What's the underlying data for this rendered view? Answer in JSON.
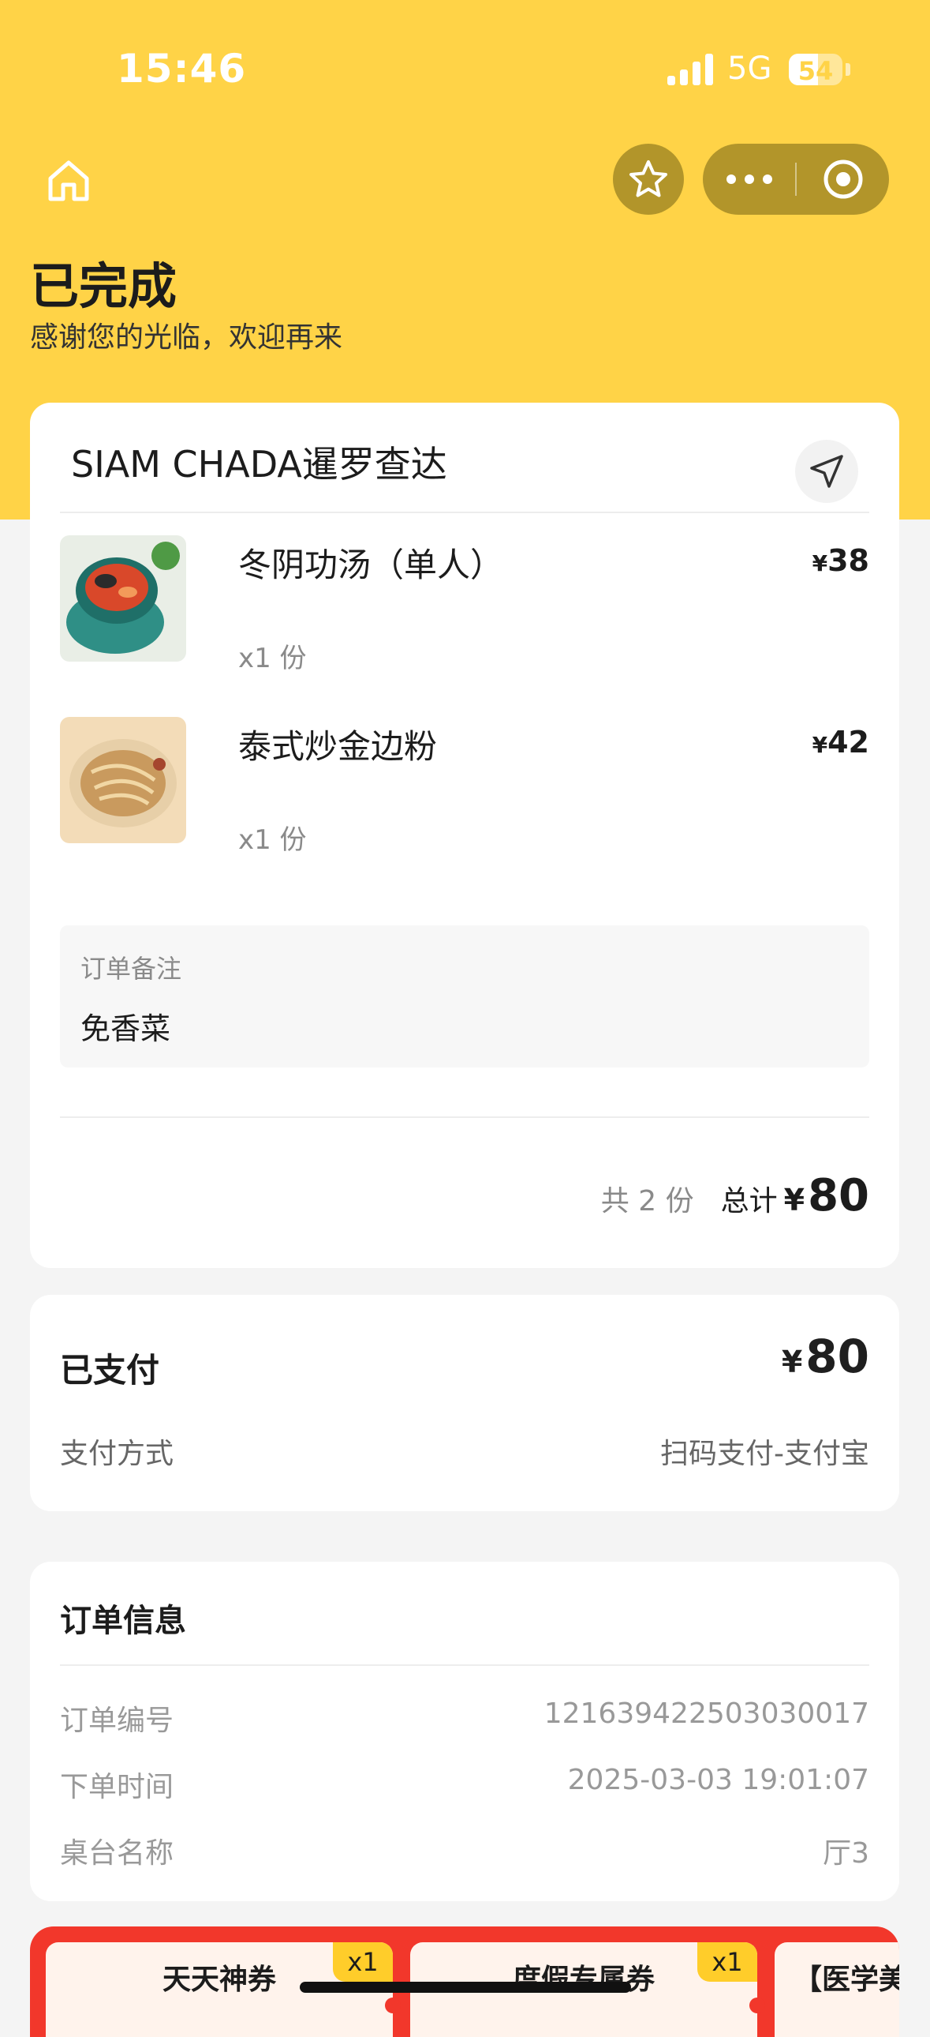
{
  "status_bar": {
    "time": "15:46",
    "network": "5G",
    "battery": "54",
    "battery_level": 0.54
  },
  "nav": {
    "home_icon": "home-icon",
    "star_icon": "star-icon",
    "more_icon": "more-dots-icon",
    "target_icon": "target-icon"
  },
  "order_status": {
    "title": "已完成",
    "subtitle": "感谢您的光临，欢迎再来"
  },
  "store": {
    "name": "SIAM CHADA暹罗查达",
    "nav_icon": "navigate-arrow-icon"
  },
  "items": [
    {
      "name": "冬阴功汤（单人）",
      "qty": "x1 份",
      "currency": "¥",
      "price": "38"
    },
    {
      "name": "泰式炒金边粉",
      "qty": "x1 份",
      "currency": "¥",
      "price": "42"
    }
  ],
  "remark": {
    "label": "订单备注",
    "value": "免香菜"
  },
  "totals": {
    "count_text": "共 2 份",
    "total_label": "总计",
    "currency": "¥",
    "amount": "80"
  },
  "payment": {
    "title": "已支付",
    "currency": "¥",
    "amount": "80",
    "method_label": "支付方式",
    "method_value": "扫码支付-支付宝"
  },
  "order_info": {
    "title": "订单信息",
    "rows": [
      {
        "key": "订单编号",
        "value": "1216394225030300​17"
      },
      {
        "key": "下单时间",
        "value": "2025-03-03 19:01:07"
      },
      {
        "key": "桌台名称",
        "value": "厅3"
      }
    ]
  },
  "coupons": [
    {
      "title": "天天神券",
      "badge": "x1"
    },
    {
      "title": "度假专属券",
      "badge": "x1"
    },
    {
      "title": "【医学美",
      "badge": ""
    }
  ],
  "colors": {
    "header_bg": "#ffd347",
    "capsule_bg": "#b2952a",
    "coupon_bg": "#f2372b",
    "badge": "#ffcd2a"
  }
}
